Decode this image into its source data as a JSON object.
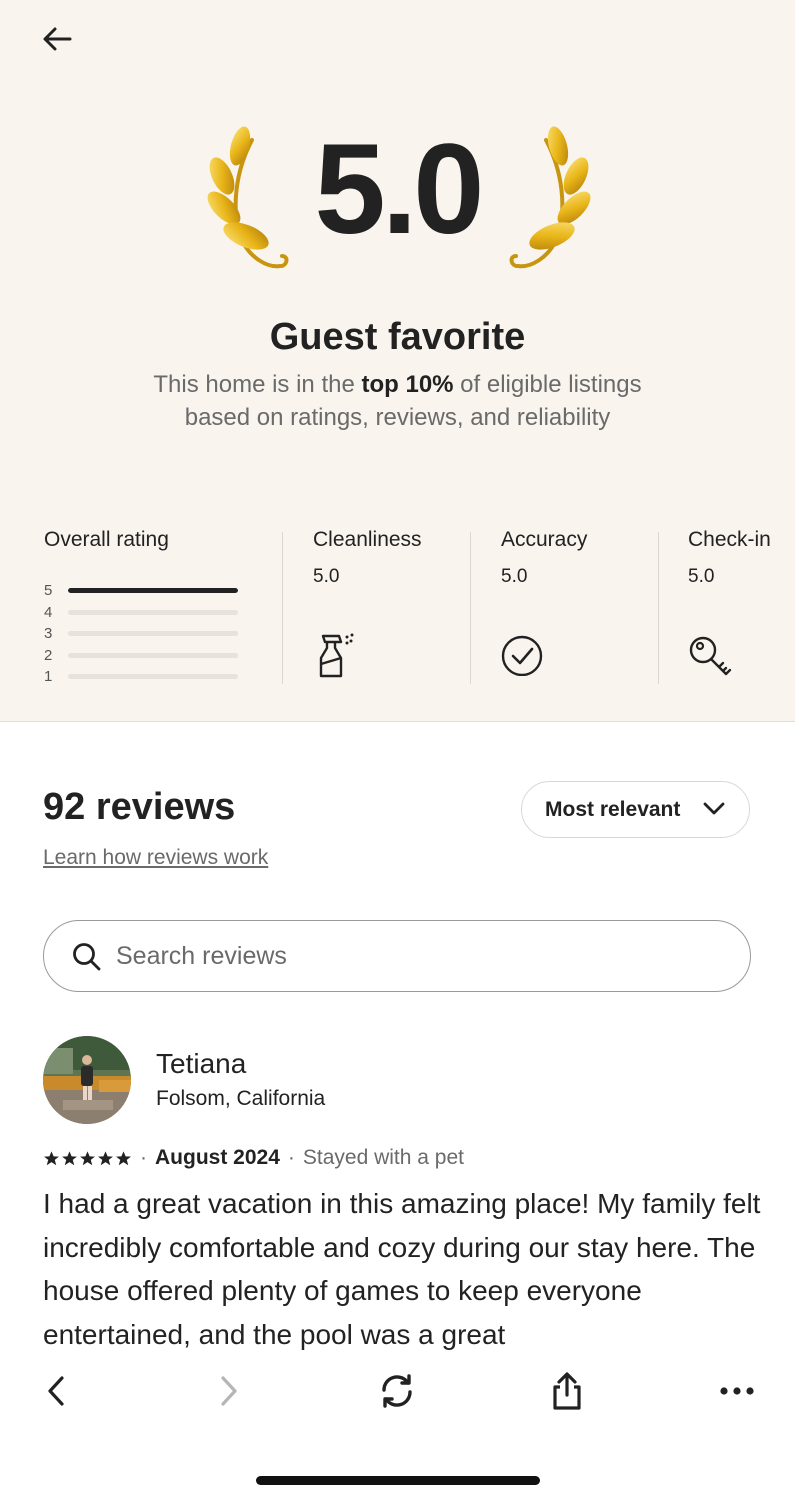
{
  "hero": {
    "score": "5.0",
    "title": "Guest favorite",
    "desc_part1": "This home is in the ",
    "desc_bold": "top 10%",
    "desc_part2": " of eligible listings",
    "desc_line2": "based on ratings, reviews, and reliability"
  },
  "ratings": {
    "overall": {
      "title": "Overall rating",
      "bars": [
        {
          "label": "5",
          "fraction": 1.0
        },
        {
          "label": "4",
          "fraction": 0
        },
        {
          "label": "3",
          "fraction": 0
        },
        {
          "label": "2",
          "fraction": 0
        },
        {
          "label": "1",
          "fraction": 0
        }
      ]
    },
    "categories": [
      {
        "title": "Cleanliness",
        "value": "5.0",
        "icon": "spray-bottle-icon"
      },
      {
        "title": "Accuracy",
        "value": "5.0",
        "icon": "check-circle-icon"
      },
      {
        "title": "Check-in",
        "value": "5.0",
        "icon": "key-icon"
      }
    ]
  },
  "reviews": {
    "count_label": "92 reviews",
    "learn_link": "Learn how reviews work",
    "sort_label": "Most relevant",
    "search_placeholder": "Search reviews"
  },
  "review": {
    "name": "Tetiana",
    "location": "Folsom, California",
    "stars": "★★★★★",
    "rating": 5,
    "separator": "·",
    "date": "August 2024",
    "stay_type": "Stayed with a pet",
    "text": "I had a great vacation in this amazing place! My family felt incredibly comfortable and cozy during our stay here. The house offered plenty of games to keep everyone entertained, and the pool was a great"
  },
  "browser": {
    "icons": [
      "back-chevron-icon",
      "forward-chevron-icon",
      "reload-icon",
      "share-icon",
      "more-icon"
    ]
  },
  "colors": {
    "hero_bg": "#f9f4ee",
    "laurel_gold": "#e9b61a",
    "text_primary": "#222222",
    "text_secondary": "#6a6a6a"
  }
}
